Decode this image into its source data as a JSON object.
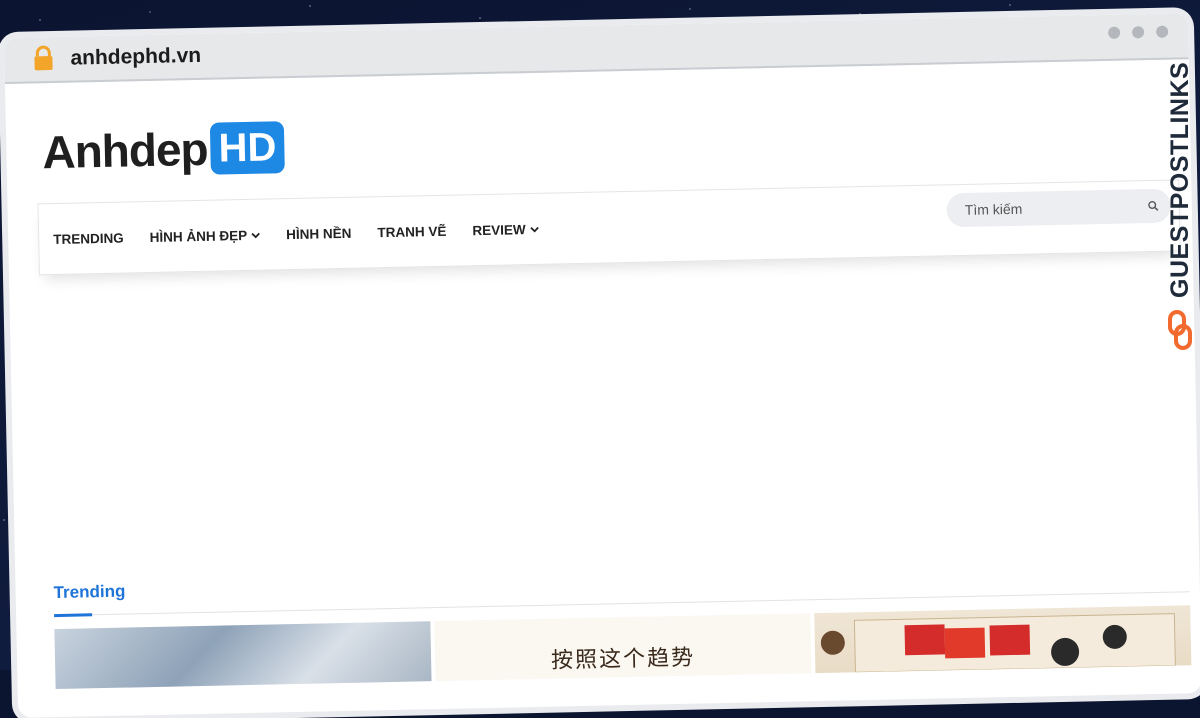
{
  "browser": {
    "url": "anhdephd.vn"
  },
  "site": {
    "logo_text": "Anhdep",
    "logo_badge": "HD"
  },
  "nav": {
    "items": [
      {
        "label": "TRENDING",
        "has_dropdown": false
      },
      {
        "label": "HÌNH ẢNH ĐẸP",
        "has_dropdown": true
      },
      {
        "label": "HÌNH NỀN",
        "has_dropdown": false
      },
      {
        "label": "TRANH VẼ",
        "has_dropdown": false
      },
      {
        "label": "REVIEW",
        "has_dropdown": true
      }
    ],
    "search_placeholder": "Tìm kiếm"
  },
  "section": {
    "title": "Trending"
  },
  "cards": [
    {
      "caption": ""
    },
    {
      "caption": "按照这个趋势"
    },
    {
      "caption": ""
    }
  ],
  "watermark": {
    "text": "GUESTPOSTLINKS",
    "accent_color": "#f26a2e"
  },
  "colors": {
    "brand_blue": "#1e88e5",
    "link_blue": "#1e74d8"
  }
}
